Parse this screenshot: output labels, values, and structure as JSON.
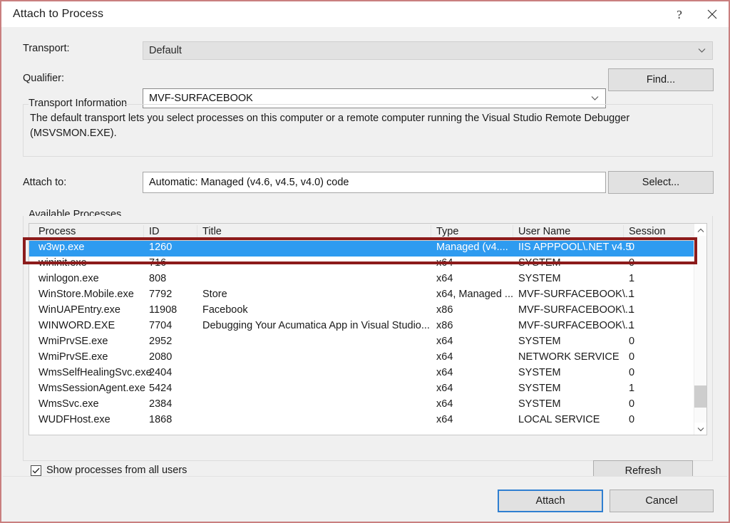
{
  "window": {
    "title": "Attach to Process",
    "help_icon": "?",
    "close_icon": "close-icon"
  },
  "fields": {
    "transport_label": "Transport:",
    "transport_value": "Default",
    "qualifier_label": "Qualifier:",
    "qualifier_value": "MVF-SURFACEBOOK",
    "find_button": "Find...",
    "attach_to_label": "Attach to:",
    "attach_to_value": "Automatic: Managed (v4.6, v4.5, v4.0) code",
    "select_button": "Select..."
  },
  "transport_info": {
    "legend": "Transport Information",
    "line1": "The default transport lets you select processes on this computer or a remote computer running the Visual Studio Remote Debugger",
    "line2": "(MSVSMON.EXE)."
  },
  "available_processes": {
    "legend": "Available Processes",
    "columns": [
      "Process",
      "ID",
      "Title",
      "Type",
      "User Name",
      "Session"
    ],
    "rows": [
      {
        "process": "w3wp.exe",
        "id": "1260",
        "title": "",
        "type": "Managed (v4....",
        "user": "IIS APPPOOL\\.NET v4.5",
        "session": "0",
        "selected": true
      },
      {
        "process": "wininit.exe",
        "id": "716",
        "title": "",
        "type": "x64",
        "user": "SYSTEM",
        "session": "0",
        "selected": false
      },
      {
        "process": "winlogon.exe",
        "id": "808",
        "title": "",
        "type": "x64",
        "user": "SYSTEM",
        "session": "1",
        "selected": false
      },
      {
        "process": "WinStore.Mobile.exe",
        "id": "7792",
        "title": "Store",
        "type": "x64, Managed ...",
        "user": "MVF-SURFACEBOOK\\...",
        "session": "1",
        "selected": false
      },
      {
        "process": "WinUAPEntry.exe",
        "id": "11908",
        "title": "Facebook",
        "type": "x86",
        "user": "MVF-SURFACEBOOK\\...",
        "session": "1",
        "selected": false
      },
      {
        "process": "WINWORD.EXE",
        "id": "7704",
        "title": "Debugging Your Acumatica App in Visual Studio...",
        "type": "x86",
        "user": "MVF-SURFACEBOOK\\...",
        "session": "1",
        "selected": false
      },
      {
        "process": "WmiPrvSE.exe",
        "id": "2952",
        "title": "",
        "type": "x64",
        "user": "SYSTEM",
        "session": "0",
        "selected": false
      },
      {
        "process": "WmiPrvSE.exe",
        "id": "2080",
        "title": "",
        "type": "x64",
        "user": "NETWORK SERVICE",
        "session": "0",
        "selected": false
      },
      {
        "process": "WmsSelfHealingSvc.exe",
        "id": "2404",
        "title": "",
        "type": "x64",
        "user": "SYSTEM",
        "session": "0",
        "selected": false
      },
      {
        "process": "WmsSessionAgent.exe",
        "id": "5424",
        "title": "",
        "type": "x64",
        "user": "SYSTEM",
        "session": "1",
        "selected": false
      },
      {
        "process": "WmsSvc.exe",
        "id": "2384",
        "title": "",
        "type": "x64",
        "user": "SYSTEM",
        "session": "0",
        "selected": false
      },
      {
        "process": "WUDFHost.exe",
        "id": "1868",
        "title": "",
        "type": "x64",
        "user": "LOCAL SERVICE",
        "session": "0",
        "selected": false
      }
    ],
    "show_all_users_label": "Show processes from all users",
    "show_all_users_checked": true,
    "refresh_button": "Refresh"
  },
  "footer": {
    "attach_button": "Attach",
    "cancel_button": "Cancel"
  },
  "colors": {
    "selection_blue": "#2e9bf0",
    "default_button_border": "#2f7fd1",
    "annotation_red": "#8c1b1b",
    "dialog_background": "#f0f0f0"
  }
}
